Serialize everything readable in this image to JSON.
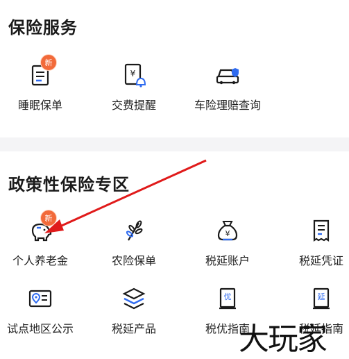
{
  "insurance_services": {
    "title": "保险服务",
    "items": [
      {
        "label": "睡眠保单",
        "icon": "policy-doc-icon",
        "badge": "新"
      },
      {
        "label": "交费提醒",
        "icon": "payment-reminder-icon",
        "badge": ""
      },
      {
        "label": "车险理赔查询",
        "icon": "car-insurance-icon",
        "badge": ""
      }
    ]
  },
  "policy_zone": {
    "title": "政策性保险专区",
    "items": [
      {
        "label": "个人养老金",
        "icon": "piggy-bank-icon",
        "badge": "新"
      },
      {
        "label": "农险保单",
        "icon": "wheat-icon",
        "badge": ""
      },
      {
        "label": "税延账户",
        "icon": "money-bag-icon",
        "badge": ""
      },
      {
        "label": "税延凭证",
        "icon": "receipt-icon",
        "badge": ""
      },
      {
        "label": "试点地区公示",
        "icon": "location-card-icon",
        "badge": ""
      },
      {
        "label": "税延产品",
        "icon": "layers-icon",
        "badge": ""
      },
      {
        "label": "税优指南",
        "icon": "guide-book-icon",
        "badge": ""
      },
      {
        "label": "税延指南",
        "icon": "guide-book-icon",
        "badge": ""
      }
    ]
  },
  "icon_text": {
    "yen": "¥",
    "you": "优",
    "yan": "延"
  },
  "watermark": "大玩家",
  "colors": {
    "accent_blue": "#2f6bf0",
    "badge_orange": "#f26a3a",
    "arrow_red": "#e01a1a",
    "divider_gray": "#f4f4f6"
  }
}
